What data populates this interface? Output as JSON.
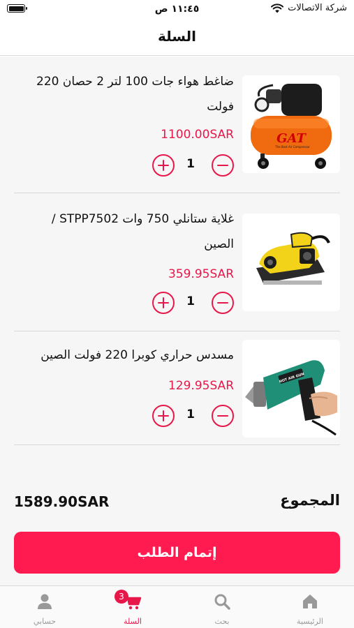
{
  "status_bar": {
    "time": "١١:٤٥ ص",
    "carrier": "شركة الاتصالات"
  },
  "header": {
    "title": "السلة"
  },
  "cart": {
    "items": [
      {
        "name": "ضاغط هواء جات 100 لتر 2 حصان 220 فولت",
        "price": "1100.00SAR",
        "quantity": "1",
        "image_icon": "air-compressor"
      },
      {
        "name": "غلاية ستانلي 750 وات STPP7502 / الصين",
        "price": "359.95SAR",
        "quantity": "1",
        "image_icon": "electric-planer"
      },
      {
        "name": "مسدس حراري كوبرا 220 فولت الصين",
        "price": "129.95SAR",
        "quantity": "1",
        "image_icon": "heat-gun"
      }
    ],
    "total_label": "المجموع",
    "total_value": "1589.90SAR",
    "checkout_label": "إتمام الطلب"
  },
  "product_images": {
    "compressor_brand": "GAT",
    "compressor_tagline": "The Best Air Compressor",
    "heat_gun_label": "HOT AIR GUN"
  },
  "tab_bar": {
    "home": "الرئيسية",
    "search": "بحث",
    "cart": "السلة",
    "cart_badge": "3",
    "account": "حسابي"
  },
  "colors": {
    "accent": "#e8174a",
    "checkout_button": "#ff1a4f",
    "divider": "#d8d8d8",
    "content_background": "#f6f6f6"
  }
}
